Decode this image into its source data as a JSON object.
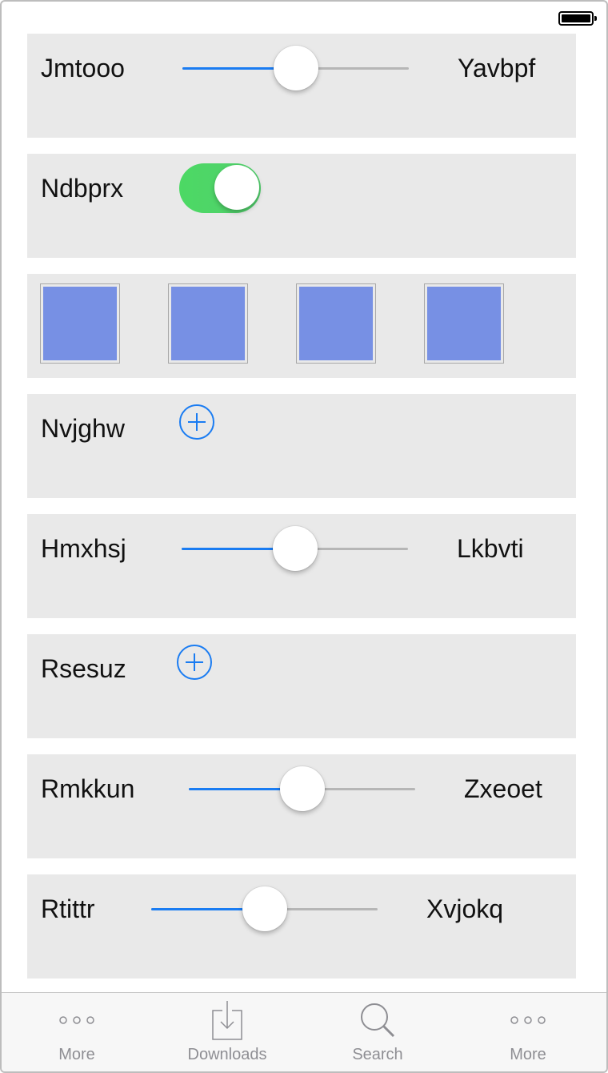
{
  "colors": {
    "accent": "#1a7cf2",
    "toggle_on": "#4cd964",
    "card_background": "#e9e9e9",
    "swatch": "#7790e4",
    "tab_inactive": "#8e8e93"
  },
  "rows": {
    "row1": {
      "left_label": "Jmtooo",
      "right_label": "Yavbpf",
      "slider_value": 0.5
    },
    "row2": {
      "label": "Ndbprx",
      "toggle_on": true
    },
    "row3": {
      "swatches": [
        "#7790e4",
        "#7790e4",
        "#7790e4",
        "#7790e4"
      ]
    },
    "row4": {
      "label": "Nvjghw",
      "icon": "add-circle-icon"
    },
    "row5": {
      "left_label": "Hmxhsj",
      "right_label": "Lkbvti",
      "slider_value": 0.5
    },
    "row6": {
      "label": "Rsesuz",
      "icon": "add-circle-icon"
    },
    "row7": {
      "left_label": "Rmkkun",
      "right_label": "Zxeoet",
      "slider_value": 0.5
    },
    "row8": {
      "left_label": "Rtittr",
      "right_label": "Xvjokq",
      "slider_value": 0.5
    }
  },
  "tab_bar": {
    "tabs": [
      {
        "label": "More",
        "icon": "more-dots-icon"
      },
      {
        "label": "Downloads",
        "icon": "downloads-icon"
      },
      {
        "label": "Search",
        "icon": "search-icon"
      },
      {
        "label": "More",
        "icon": "more-dots-icon"
      }
    ]
  }
}
